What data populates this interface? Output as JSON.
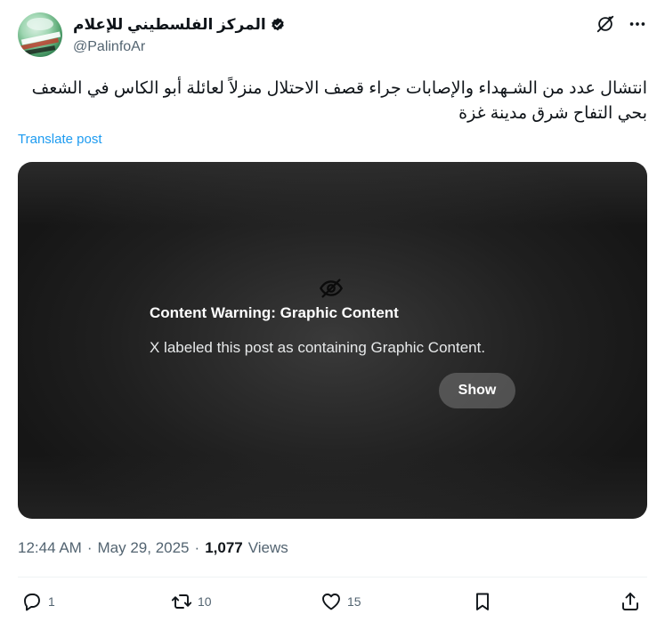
{
  "author": {
    "display_name": "المركز الفلسطيني للإعلام",
    "handle": "@PalinfoAr",
    "verified": true,
    "avatar_icon": "palinfo-logo"
  },
  "top_actions": {
    "grok_icon": "grok-icon",
    "more_icon": "more-icon",
    "more_label": "•••"
  },
  "post": {
    "text": "انتشال عدد من الشـهداء والإصابات جراء قصف الاحتلال منزلاً لعائلة أبو الكاس في الشعف بحي التفاح شرق مدينة غزة",
    "translate_label": "Translate post"
  },
  "media": {
    "warning_icon": "eye-slash-icon",
    "warning_title": "Content Warning: Graphic Content",
    "warning_body": "X labeled this post as containing Graphic Content.",
    "show_label": "Show"
  },
  "meta": {
    "time": "12:44 AM",
    "separator": "·",
    "date": "May 29, 2025",
    "views_count": "1,077",
    "views_label": "Views"
  },
  "actions": {
    "replies": "1",
    "reposts": "10",
    "likes": "15"
  },
  "colors": {
    "accent": "#1d9bf0",
    "text_secondary": "#536471"
  }
}
